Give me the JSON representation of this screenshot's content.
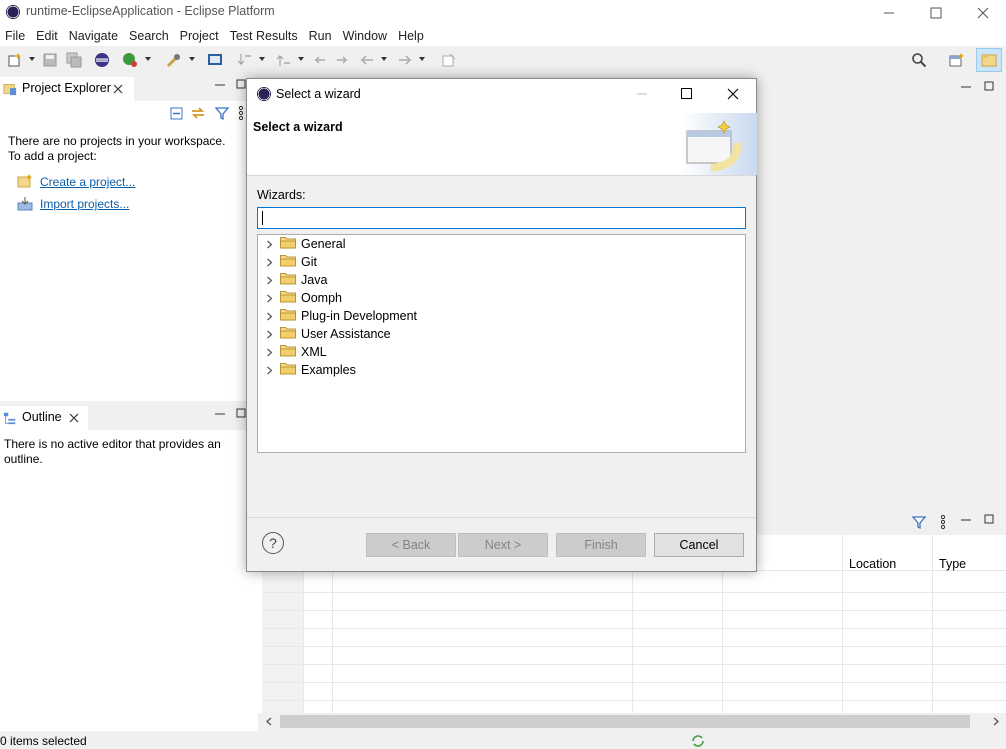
{
  "window": {
    "title": "runtime-EclipseApplication - Eclipse Platform",
    "minimize": "—",
    "maximize": "☐",
    "close": "✕"
  },
  "menu": [
    "File",
    "Edit",
    "Navigate",
    "Search",
    "Project",
    "Test Results",
    "Run",
    "Window",
    "Help"
  ],
  "project_explorer": {
    "tab_label": "Project Explorer",
    "msg_line1": "There are no projects in your workspace.",
    "msg_line2": "To add a project:",
    "create_link": "Create a project...",
    "import_link": "Import projects..."
  },
  "outline": {
    "tab_label": "Outline",
    "msg_line1": "There is no active editor that provides an",
    "msg_line2": "outline."
  },
  "problems": {
    "columns": [
      "Location",
      "Type"
    ]
  },
  "status_bar": {
    "text": "0 items selected"
  },
  "dialog": {
    "title": "Select a wizard",
    "header_title": "Select a wizard",
    "filter_label": "Wizards:",
    "filter_value": "",
    "wizards": [
      "General",
      "Git",
      "Java",
      "Oomph",
      "Plug-in Development",
      "User Assistance",
      "XML",
      "Examples"
    ],
    "buttons": {
      "back": "< Back",
      "next": "Next >",
      "finish": "Finish",
      "cancel": "Cancel"
    },
    "help_glyph": "?"
  },
  "colors": {
    "accent": "#0078d7",
    "link": "#0b5ea8",
    "folder": "#e8c25a"
  }
}
